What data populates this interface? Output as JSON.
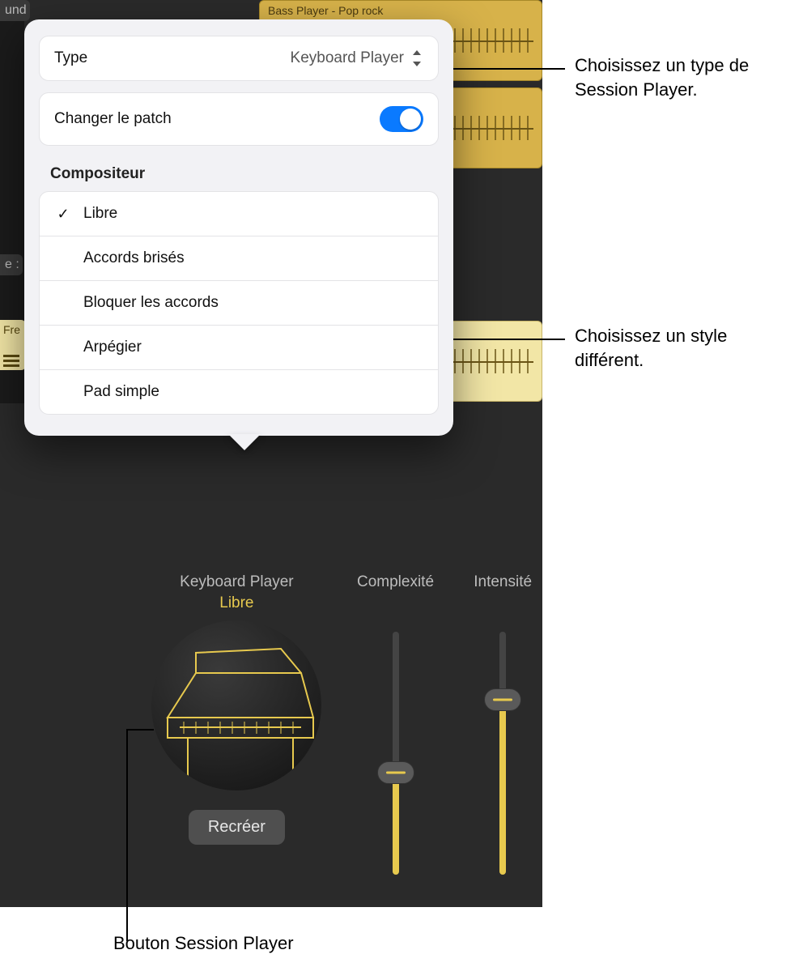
{
  "popover": {
    "type_label": "Type",
    "type_value": "Keyboard Player",
    "change_patch_label": "Changer le patch",
    "section_title": "Compositeur",
    "styles": [
      {
        "label": "Libre",
        "checked": true
      },
      {
        "label": "Accords brisés",
        "checked": false
      },
      {
        "label": "Bloquer les accords",
        "checked": false
      },
      {
        "label": "Arpégier",
        "checked": false
      },
      {
        "label": "Pad simple",
        "checked": false
      }
    ]
  },
  "inspector": {
    "player_title": "Keyboard Player",
    "player_style": "Libre",
    "recreate_button": "Recréer",
    "complexity_label": "Complexité",
    "intensity_label": "Intensité",
    "complexity_value": 42,
    "intensity_value": 72
  },
  "tracks": {
    "bass_label": "Bass Player - Pop rock",
    "left_und": "und",
    "left_colon": "e :",
    "left_fre": "Fre"
  },
  "callouts": {
    "type": "Choisissez un type de Session Player.",
    "style": "Choisissez un style différent.",
    "button": "Bouton Session Player"
  }
}
